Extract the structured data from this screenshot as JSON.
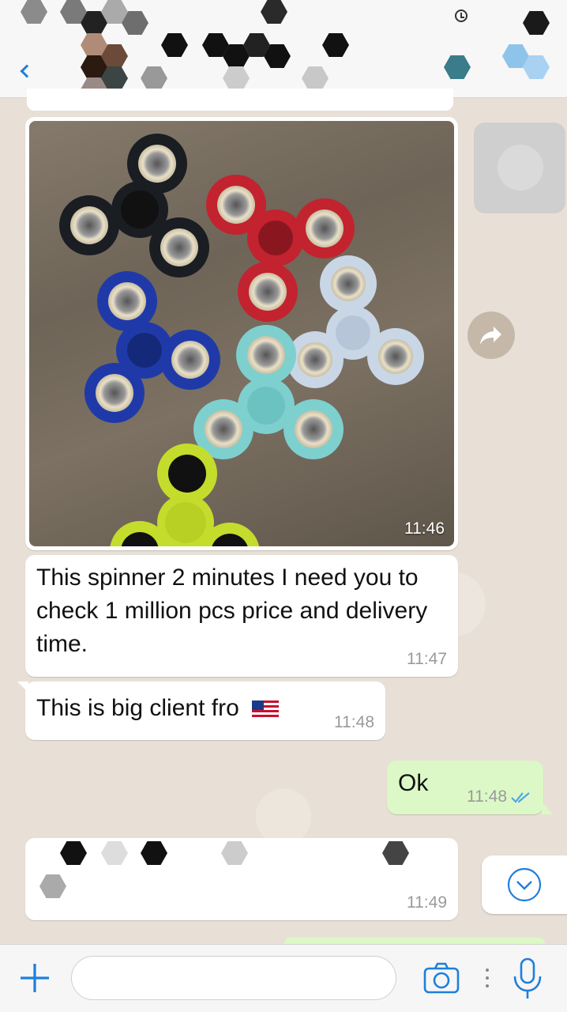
{
  "header": {
    "back_icon": "chevron-left-icon",
    "timer_icon": "disappearing-timer-icon",
    "contact_name": "",
    "redacted": true
  },
  "messages": [
    {
      "type": "image",
      "direction": "incoming",
      "time": "11:46",
      "content": "fidget spinners photo"
    },
    {
      "type": "text",
      "direction": "incoming",
      "text": "This spinner 2 minutes I need you to check 1 million pcs price and delivery time.",
      "time": "11:47"
    },
    {
      "type": "text",
      "direction": "incoming",
      "text": "This is big client fro",
      "emoji": "us-flag",
      "time": "11:48"
    },
    {
      "type": "text",
      "direction": "outgoing",
      "text": "Ok",
      "time": "11:48",
      "status_icon": "double-check-blue-icon"
    },
    {
      "type": "text",
      "direction": "incoming",
      "text": "",
      "redacted": true,
      "time": "11:49"
    }
  ],
  "side_controls": {
    "forward_icon": "forward-arrow-icon",
    "scroll_down_icon": "chevron-down-circle-icon"
  },
  "composer": {
    "placeholder": "",
    "value": "",
    "plus_icon": "plus-icon",
    "camera_icon": "camera-icon",
    "more_icon": "vertical-dots-icon",
    "mic_icon": "microphone-icon"
  },
  "colors": {
    "incoming_bubble": "#ffffff",
    "outgoing_bubble": "#dcf8c6",
    "accent": "#1e7fdc",
    "timestamp": "#9a9a9a",
    "read_ticks": "#4fa8e8"
  }
}
